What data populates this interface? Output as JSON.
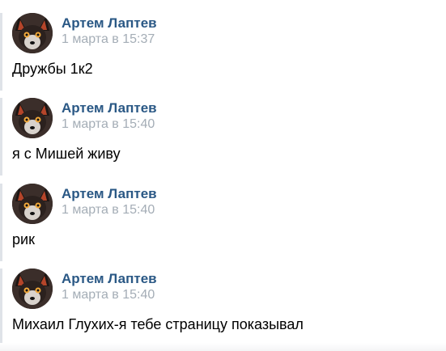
{
  "messages": [
    {
      "author": "Артем Лаптев",
      "time": "1 марта в 15:37",
      "text": "Дружбы 1к2",
      "avatar_icon": "fox-avatar"
    },
    {
      "author": "Артем Лаптев",
      "time": "1 марта в 15:40",
      "text": "я с Мишей живу",
      "avatar_icon": "fox-avatar"
    },
    {
      "author": "Артем Лаптев",
      "time": "1 марта в 15:40",
      "text": "рик",
      "avatar_icon": "fox-avatar"
    },
    {
      "author": "Артем Лаптев",
      "time": "1 марта в 15:40",
      "text": "Михаил Глухих-я тебе страницу показывал",
      "avatar_icon": "fox-avatar"
    }
  ],
  "colors": {
    "author": "#2a5885",
    "timestamp": "#a4adb6",
    "text": "#000000",
    "left_rule": "#dfe3e8"
  }
}
